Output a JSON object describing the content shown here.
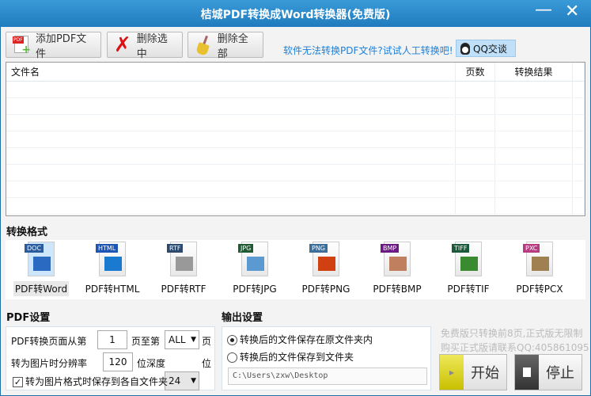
{
  "window": {
    "title": "桔城PDF转换成Word转换器(免费版)",
    "minimize": "—",
    "close": "✕"
  },
  "toolbar": {
    "add_pdf": "添加PDF文件",
    "delete_selected": "删除选中",
    "delete_all": "删除全部",
    "hint_link": "软件无法转换PDF文件?试试人工转换吧!",
    "qq_chat": "QQ交谈"
  },
  "file_table": {
    "columns": [
      "文件名",
      "页数",
      "转换结果"
    ],
    "rows": []
  },
  "formats": {
    "label": "转换格式",
    "selected": 0,
    "items": [
      {
        "tag": "DOC",
        "label": "PDF转Word",
        "color": "#2a5b9c"
      },
      {
        "tag": "HTML",
        "label": "PDF转HTML",
        "color": "#1d55b5"
      },
      {
        "tag": "RTF",
        "label": "PDF转RTF",
        "color": "#2b4a6e"
      },
      {
        "tag": "JPG",
        "label": "PDF转JPG",
        "color": "#1f5a35"
      },
      {
        "tag": "PNG",
        "label": "PDF转PNG",
        "color": "#3d6e98"
      },
      {
        "tag": "BMP",
        "label": "PDF转BMP",
        "color": "#6a1a80"
      },
      {
        "tag": "TIFF",
        "label": "PDF转TIF",
        "color": "#1a5a3a"
      },
      {
        "tag": "PXC",
        "label": "PDF转PCX",
        "color": "#b83a80"
      }
    ]
  },
  "pdf_settings": {
    "label": "PDF设置",
    "page_from_label": "PDF转换页面从第",
    "page_from": "1",
    "page_to_label": "页至第",
    "page_to": "ALL",
    "page_suffix": "页",
    "dpi_label": "转为图片时分辨率",
    "dpi": "120",
    "depth_label": "位深度",
    "depth": "24",
    "depth_suffix": "位",
    "save_each_label": "转为图片格式时保存到各自文件夹",
    "save_each_checked": true
  },
  "output_settings": {
    "label": "输出设置",
    "option_original": "转换后的文件保存在原文件夹内",
    "option_folder": "转换后的文件保存到文件夹",
    "selected": "original",
    "folder_path": "C:\\Users\\zxw\\Desktop"
  },
  "notice": {
    "line1": "免费版只转换前8页,正式版无限制",
    "line2": "购买正式版请联系QQ:405861095"
  },
  "actions": {
    "start": "开始",
    "stop": "停止"
  }
}
